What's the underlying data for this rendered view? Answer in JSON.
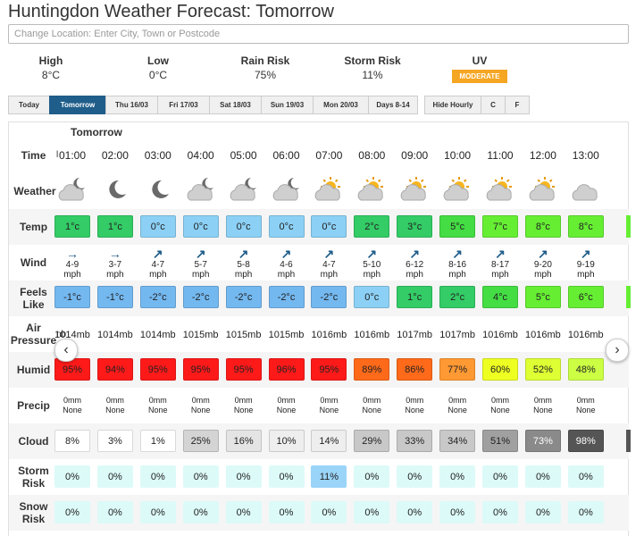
{
  "header": {
    "title": "Huntingdon Weather Forecast: Tomorrow"
  },
  "search": {
    "placeholder": "Change Location: Enter City, Town or Postcode"
  },
  "summary": {
    "high_label": "High",
    "high_value": "8°C",
    "low_label": "Low",
    "low_value": "0°C",
    "rain_label": "Rain Risk",
    "rain_value": "75%",
    "storm_label": "Storm Risk",
    "storm_value": "11%",
    "uv_label": "UV",
    "uv_value": "MODERATE"
  },
  "tabs": [
    "Today",
    "Tomorrow",
    "Thu 16/03",
    "Fri 17/03",
    "Sat 18/03",
    "Sun 19/03",
    "Mon 20/03",
    "Days 8-14",
    "Hide Hourly",
    "C",
    "F"
  ],
  "grid": {
    "day_label": "Tomorrow",
    "row_labels": {
      "time": "Time",
      "weather": "Weather",
      "temp": "Temp",
      "wind": "Wind",
      "feels1": "Feels",
      "feels2": "Like",
      "air1": "Air",
      "air2": "Pressure",
      "humid": "Humid",
      "precip": "Precip",
      "cloud": "Cloud",
      "storm1": "Storm",
      "storm2": "Risk",
      "snow1": "Snow",
      "snow2": "Risk"
    },
    "truncated": {
      "time": "l",
      "pressure": "nb"
    },
    "hours": [
      "01:00",
      "02:00",
      "03:00",
      "04:00",
      "05:00",
      "06:00",
      "07:00",
      "08:00",
      "09:00",
      "10:00",
      "11:00",
      "12:00",
      "13:00"
    ],
    "icons": [
      "cloudy-night-icon",
      "moon-icon",
      "moon-icon",
      "cloudy-night-icon",
      "cloudy-night-icon",
      "cloudy-night-icon",
      "sun-cloud-icon",
      "sun-cloud-icon",
      "sun-cloud-icon",
      "sun-cloud-icon",
      "sun-cloud-icon",
      "sun-cloud-icon",
      "cloud-icon"
    ],
    "temp": [
      "1°c",
      "1°c",
      "0°c",
      "0°c",
      "0°c",
      "0°c",
      "0°c",
      "2°c",
      "3°c",
      "5°c",
      "7°c",
      "8°c",
      "8°c"
    ],
    "wind_arrows": [
      "→",
      "→",
      "↗",
      "↗",
      "↗",
      "↗",
      "↗",
      "↗",
      "↗",
      "↗",
      "↗",
      "↗",
      "↗"
    ],
    "wind_speed": [
      "4-9",
      "3-7",
      "4-7",
      "5-7",
      "5-8",
      "4-6",
      "4-7",
      "5-10",
      "6-12",
      "8-16",
      "8-17",
      "9-20",
      "9-19"
    ],
    "wind_unit": "mph",
    "feels": [
      "-1°c",
      "-1°c",
      "-2°c",
      "-2°c",
      "-2°c",
      "-2°c",
      "-2°c",
      "0°c",
      "1°c",
      "2°c",
      "4°c",
      "5°c",
      "6°c"
    ],
    "pressure": [
      "1014mb",
      "1014mb",
      "1014mb",
      "1015mb",
      "1015mb",
      "1015mb",
      "1016mb",
      "1016mb",
      "1017mb",
      "1017mb",
      "1016mb",
      "1016mb",
      "1016mb"
    ],
    "humid": [
      "95%",
      "94%",
      "95%",
      "95%",
      "95%",
      "96%",
      "95%",
      "89%",
      "86%",
      "77%",
      "60%",
      "52%",
      "48%"
    ],
    "precip_amount": "0mm",
    "precip_type": "None",
    "cloud": [
      "8%",
      "3%",
      "1%",
      "25%",
      "16%",
      "10%",
      "14%",
      "29%",
      "33%",
      "34%",
      "51%",
      "73%",
      "98%"
    ],
    "storm": [
      "0%",
      "0%",
      "0%",
      "0%",
      "0%",
      "0%",
      "11%",
      "0%",
      "0%",
      "0%",
      "0%",
      "0%",
      "0%"
    ],
    "snow": [
      "0%",
      "0%",
      "0%",
      "0%",
      "0%",
      "0%",
      "0%",
      "0%",
      "0%",
      "0%",
      "0%",
      "0%",
      "0%"
    ]
  },
  "colors": {
    "temp": [
      "#33cc66",
      "#33cc66",
      "#8cd0f5",
      "#8cd0f5",
      "#8cd0f5",
      "#8cd0f5",
      "#8cd0f5",
      "#33cc66",
      "#33cc66",
      "#44dd44",
      "#66ee33",
      "#66ee33",
      "#66ee33"
    ],
    "feels": [
      "#74b8f0",
      "#74b8f0",
      "#74b8f0",
      "#74b8f0",
      "#74b8f0",
      "#74b8f0",
      "#74b8f0",
      "#8cd0f5",
      "#33cc66",
      "#33cc66",
      "#44dd44",
      "#66ee33",
      "#66ee33"
    ],
    "humid": [
      "#ff1a1a",
      "#ff1a1a",
      "#ff1a1a",
      "#ff1a1a",
      "#ff1a1a",
      "#ff1a1a",
      "#ff1a1a",
      "#ff6a1a",
      "#ff6a1a",
      "#ff9933",
      "#eeff22",
      "#ddff33",
      "#ccff44"
    ],
    "cloud": [
      "#ffffff",
      "#ffffff",
      "#ffffff",
      "#d4d4d4",
      "#e4e4e4",
      "#eeeeee",
      "#eeeeee",
      "#c8c8c8",
      "#c8c8c8",
      "#c8c8c8",
      "#a0a0a0",
      "#8a8a8a",
      "#555555"
    ],
    "cloud_text": [
      "#222",
      "#222",
      "#222",
      "#222",
      "#222",
      "#222",
      "#222",
      "#222",
      "#222",
      "#222",
      "#222",
      "#fff",
      "#fff"
    ],
    "storm": [
      "#dcfaf8",
      "#dcfaf8",
      "#dcfaf8",
      "#dcfaf8",
      "#dcfaf8",
      "#dcfaf8",
      "#9ad4f8",
      "#dcfaf8",
      "#dcfaf8",
      "#dcfaf8",
      "#dcfaf8",
      "#dcfaf8",
      "#dcfaf8"
    ],
    "snow": "#dcfaf8",
    "accent": "#1f5d8a",
    "uv": "#f5a623"
  }
}
